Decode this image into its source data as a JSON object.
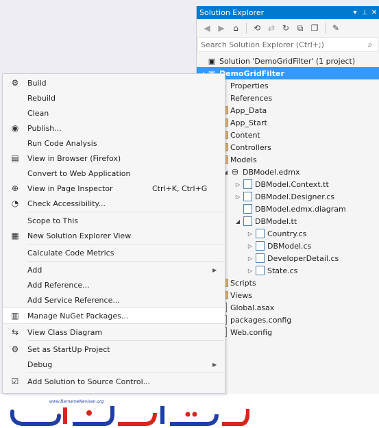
{
  "solution_explorer": {
    "title": "Solution Explorer",
    "title_buttons": [
      "▾",
      "⊥",
      "✕"
    ],
    "search_placeholder": "Search Solution Explorer (Ctrl+;)",
    "tree": [
      {
        "label": "Solution 'DemoGridFilter' (1 project)",
        "level": 0,
        "icon": "solution-icon",
        "expander": ""
      },
      {
        "label": "DemoGridFilter",
        "level": 0,
        "icon": "project-icon",
        "expander": "◢",
        "selected": true
      },
      {
        "label": "Properties",
        "level": 1,
        "icon": "wrench-icon",
        "expander": ""
      },
      {
        "label": "References",
        "level": 1,
        "icon": "references-icon",
        "expander": ""
      },
      {
        "label": "App_Data",
        "level": 1,
        "icon": "folder-icon",
        "expander": ""
      },
      {
        "label": "App_Start",
        "level": 1,
        "icon": "folder-icon",
        "expander": ""
      },
      {
        "label": "Content",
        "level": 1,
        "icon": "folder-icon",
        "expander": ""
      },
      {
        "label": "Controllers",
        "level": 1,
        "icon": "folder-icon",
        "expander": ""
      },
      {
        "label": "Models",
        "level": 1,
        "icon": "folder-icon",
        "expander": ""
      },
      {
        "label": "DBModel.edmx",
        "level": 2,
        "icon": "edmx-icon",
        "expander": "◢"
      },
      {
        "label": "DBModel.Context.tt",
        "level": 3,
        "icon": "tt-file-icon",
        "expander": "▷"
      },
      {
        "label": "DBModel.Designer.cs",
        "level": 3,
        "icon": "cs-file-icon",
        "expander": "▷"
      },
      {
        "label": "DBModel.edmx.diagram",
        "level": 3,
        "icon": "cs-file-icon",
        "expander": ""
      },
      {
        "label": "DBModel.tt",
        "level": 3,
        "icon": "tt-file-icon",
        "expander": "◢"
      },
      {
        "label": "Country.cs",
        "level": 4,
        "icon": "cs-file-icon",
        "expander": "▷"
      },
      {
        "label": "DBModel.cs",
        "level": 4,
        "icon": "cs-file-icon",
        "expander": "▷"
      },
      {
        "label": "DeveloperDetail.cs",
        "level": 4,
        "icon": "cs-file-icon",
        "expander": "▷"
      },
      {
        "label": "State.cs",
        "level": 4,
        "icon": "cs-file-icon",
        "expander": "▷"
      },
      {
        "label": "Scripts",
        "level": 1,
        "icon": "folder-icon",
        "expander": ""
      },
      {
        "label": "Views",
        "level": 1,
        "icon": "folder-icon",
        "expander": ""
      },
      {
        "label": "Global.asax",
        "level": 1,
        "icon": "asax-file-icon",
        "expander": ""
      },
      {
        "label": "packages.config",
        "level": 1,
        "icon": "config-file-icon",
        "expander": ""
      },
      {
        "label": "Web.config",
        "level": 1,
        "icon": "config-file-icon",
        "expander": ""
      }
    ]
  },
  "context_menu": {
    "items": [
      {
        "label": "Build",
        "icon": "build-icon"
      },
      {
        "label": "Rebuild",
        "icon": ""
      },
      {
        "label": "Clean",
        "icon": ""
      },
      {
        "label": "Publish...",
        "icon": "publish-icon"
      },
      {
        "label": "Run Code Analysis",
        "icon": ""
      },
      {
        "label": "View in Browser (Firefox)",
        "icon": "browser-icon"
      },
      {
        "label": "Convert to Web Application",
        "icon": ""
      },
      {
        "label": "View in Page Inspector",
        "icon": "page-inspector-icon",
        "shortcut": "Ctrl+K, Ctrl+G"
      },
      {
        "label": "Check Accessibility...",
        "icon": "accessibility-icon"
      },
      {
        "separator": true
      },
      {
        "label": "Scope to This",
        "icon": ""
      },
      {
        "label": "New Solution Explorer View",
        "icon": "new-view-icon"
      },
      {
        "separator": true
      },
      {
        "label": "Calculate Code Metrics",
        "icon": ""
      },
      {
        "separator": true
      },
      {
        "label": "Add",
        "icon": "",
        "submenu": true
      },
      {
        "label": "Add Reference...",
        "icon": ""
      },
      {
        "label": "Add Service Reference...",
        "icon": ""
      },
      {
        "label": "Manage NuGet Packages...",
        "icon": "nuget-icon",
        "highlighted": true
      },
      {
        "separator": true
      },
      {
        "label": "View Class Diagram",
        "icon": "class-diagram-icon"
      },
      {
        "separator": true
      },
      {
        "label": "Set as StartUp Project",
        "icon": "gear-icon"
      },
      {
        "label": "Debug",
        "icon": "",
        "submenu": true
      },
      {
        "separator": true
      },
      {
        "label": "Add Solution to Source Control...",
        "icon": "source-control-icon"
      }
    ]
  },
  "watermark": {
    "url": "www.BarnameNevisan.org",
    "logo_text": "برنامه نویسان",
    "colors": {
      "blue": "#1f3fa8",
      "red": "#d9261c"
    }
  },
  "colors": {
    "accent": "#007acc",
    "selection": "#3399ff"
  }
}
